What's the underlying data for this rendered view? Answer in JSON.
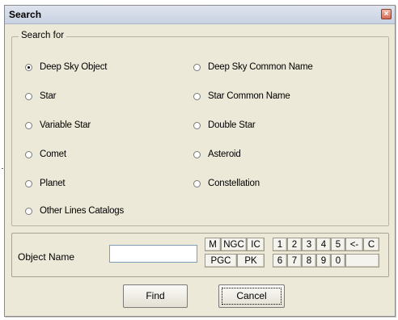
{
  "window": {
    "title": "Search",
    "close_glyph": "×"
  },
  "search_for": {
    "legend": "Search for",
    "options": [
      {
        "label": "Deep Sky Object",
        "checked": true
      },
      {
        "label": "Deep Sky Common Name",
        "checked": false
      },
      {
        "label": "Star",
        "checked": false
      },
      {
        "label": "Star Common Name",
        "checked": false
      },
      {
        "label": "Variable Star",
        "checked": false
      },
      {
        "label": "Double Star",
        "checked": false
      },
      {
        "label": "Comet",
        "checked": false
      },
      {
        "label": "Asteroid",
        "checked": false
      },
      {
        "label": "Planet",
        "checked": false
      },
      {
        "label": "Constellation",
        "checked": false
      },
      {
        "label": "Other Lines Catalogs",
        "checked": false
      }
    ]
  },
  "object_name": {
    "label": "Object Name",
    "value": "",
    "catalog_keys": [
      "M",
      "NGC",
      "IC",
      "PGC",
      "PK"
    ],
    "digit_keys": [
      "1",
      "2",
      "3",
      "4",
      "5",
      "<-",
      "C",
      "6",
      "7",
      "8",
      "9",
      "0",
      ""
    ]
  },
  "buttons": {
    "find": "Find",
    "cancel": "Cancel"
  }
}
